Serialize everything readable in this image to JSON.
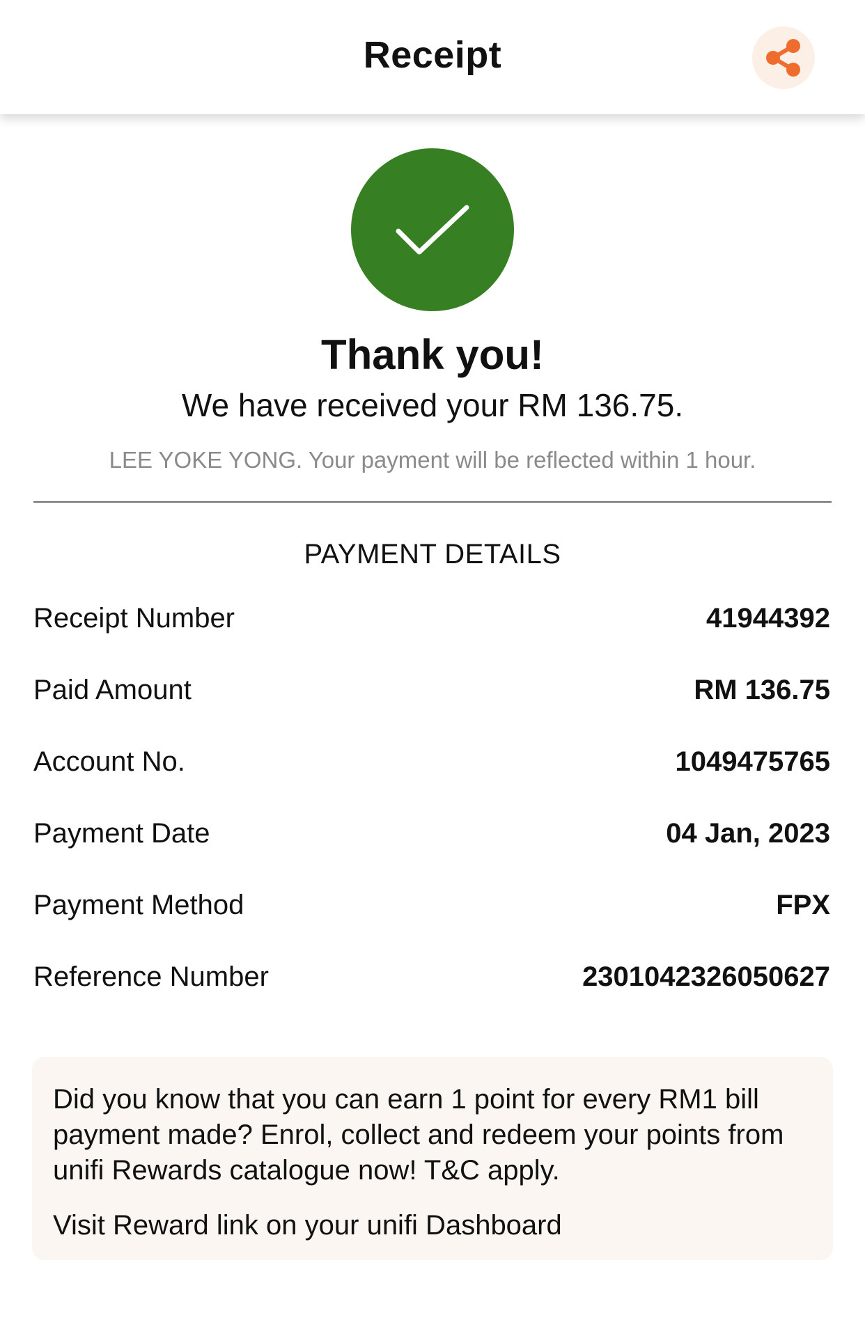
{
  "header": {
    "title": "Receipt",
    "share_icon": "share-icon",
    "accent_color": "#ee6c2d"
  },
  "status": {
    "icon": "checkmark-icon",
    "color": "#377f23",
    "heading": "Thank you!",
    "message": "We have received your RM 136.75.",
    "note": "LEE YOKE YONG. Your payment will be reflected within 1 hour."
  },
  "payment_details": {
    "title": "PAYMENT DETAILS",
    "rows": [
      {
        "label": "Receipt Number",
        "value": "41944392"
      },
      {
        "label": "Paid Amount",
        "value": "RM 136.75"
      },
      {
        "label": "Account No.",
        "value": "1049475765"
      },
      {
        "label": "Payment Date",
        "value": "04 Jan, 2023"
      },
      {
        "label": "Payment Method",
        "value": "FPX"
      },
      {
        "label": "Reference Number",
        "value": "2301042326050627"
      }
    ]
  },
  "promo": {
    "text": "Did you know that you can earn 1 point for every RM1 bill payment made? Enrol, collect and redeem your points from unifi Rewards catalogue now! T&C apply.",
    "link": "Visit Reward link on your unifi Dashboard"
  }
}
